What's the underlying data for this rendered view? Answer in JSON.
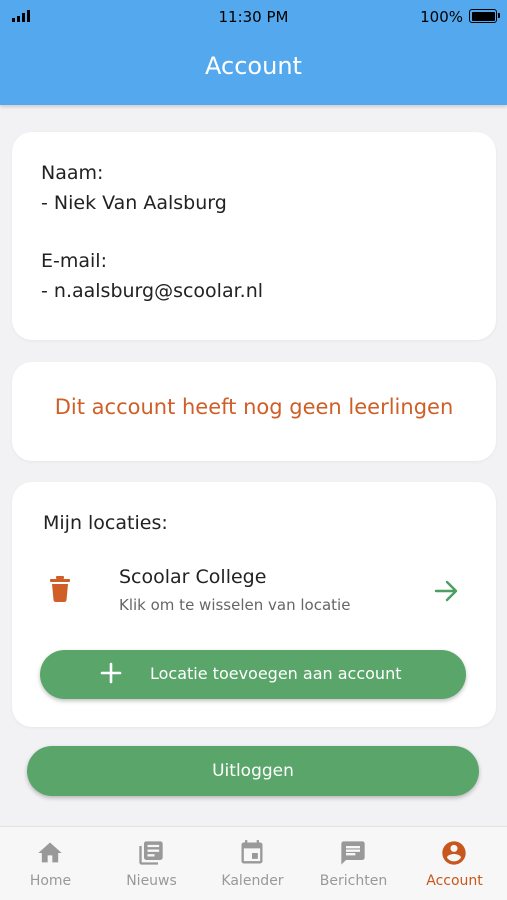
{
  "status_bar": {
    "time": "11:30 PM",
    "battery": "100%"
  },
  "header": {
    "title": "Account"
  },
  "account": {
    "name_label": "Naam:",
    "name_value": "- Niek Van Aalsburg",
    "email_label": "E-mail:",
    "email_value": "- n.aalsburg@scoolar.nl"
  },
  "students": {
    "message": "Dit account heeft nog geen leerlingen"
  },
  "locations": {
    "heading": "Mijn locaties:",
    "items": [
      {
        "name": "Scoolar College",
        "subtitle": "Klik om te wisselen van locatie",
        "icons": [
          "trash-icon",
          "arrow-right-icon"
        ]
      }
    ],
    "add_button": "Locatie toevoegen aan account"
  },
  "logout_button": "Uitloggen",
  "tabs": [
    {
      "label": "Home",
      "icon": "home-icon"
    },
    {
      "label": "Nieuws",
      "icon": "news-icon"
    },
    {
      "label": "Kalender",
      "icon": "calendar-icon"
    },
    {
      "label": "Berichten",
      "icon": "chat-icon"
    },
    {
      "label": "Account",
      "icon": "account-icon",
      "active": true
    }
  ],
  "colors": {
    "header": "#54a9ee",
    "accent_orange": "#cf5f26",
    "button_green": "#5aa66a",
    "arrow_green": "#4e9e62",
    "tab_inactive": "#999999"
  }
}
